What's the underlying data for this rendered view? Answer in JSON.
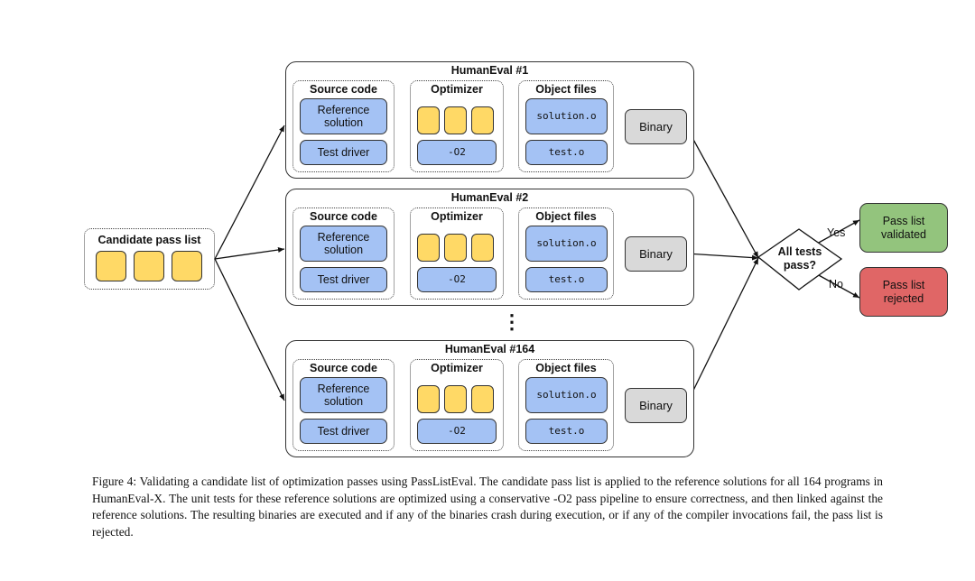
{
  "candidate": {
    "title": "Candidate pass list"
  },
  "panels": [
    {
      "title": "HumanEval #1"
    },
    {
      "title": "HumanEval #2"
    },
    {
      "title": "HumanEval #164"
    }
  ],
  "stage": {
    "source_code": "Source code",
    "optimizer": "Optimizer",
    "object_files": "Object files",
    "reference_solution": "Reference solution",
    "test_driver": "Test driver",
    "o2": "-O2",
    "solution_o": "solution.o",
    "test_o": "test.o",
    "binary": "Binary"
  },
  "ellipsis": "⋮",
  "decision": {
    "question_line1": "All tests",
    "question_line2": "pass?",
    "yes_label": "Yes",
    "no_label": "No",
    "validated_line1": "Pass list",
    "validated_line2": "validated",
    "rejected_line1": "Pass list",
    "rejected_line2": "rejected"
  },
  "colors": {
    "blue_box": "#a4c2f4",
    "yellow_pass": "#ffd966",
    "binary_gray": "#d9d9d9",
    "validated_green": "#93c47d",
    "rejected_red": "#e06666"
  },
  "caption": "Figure 4: Validating a candidate list of optimization passes using PassListEval. The candidate pass list is applied to the reference solutions for all 164 programs in HumanEval-X. The unit tests for these reference solutions are optimized using a conservative -O2 pass pipeline to ensure correctness, and then linked against the reference solutions. The resulting binaries are executed and if any of the binaries crash during execution, or if any of the compiler invocations fail, the pass list is rejected."
}
